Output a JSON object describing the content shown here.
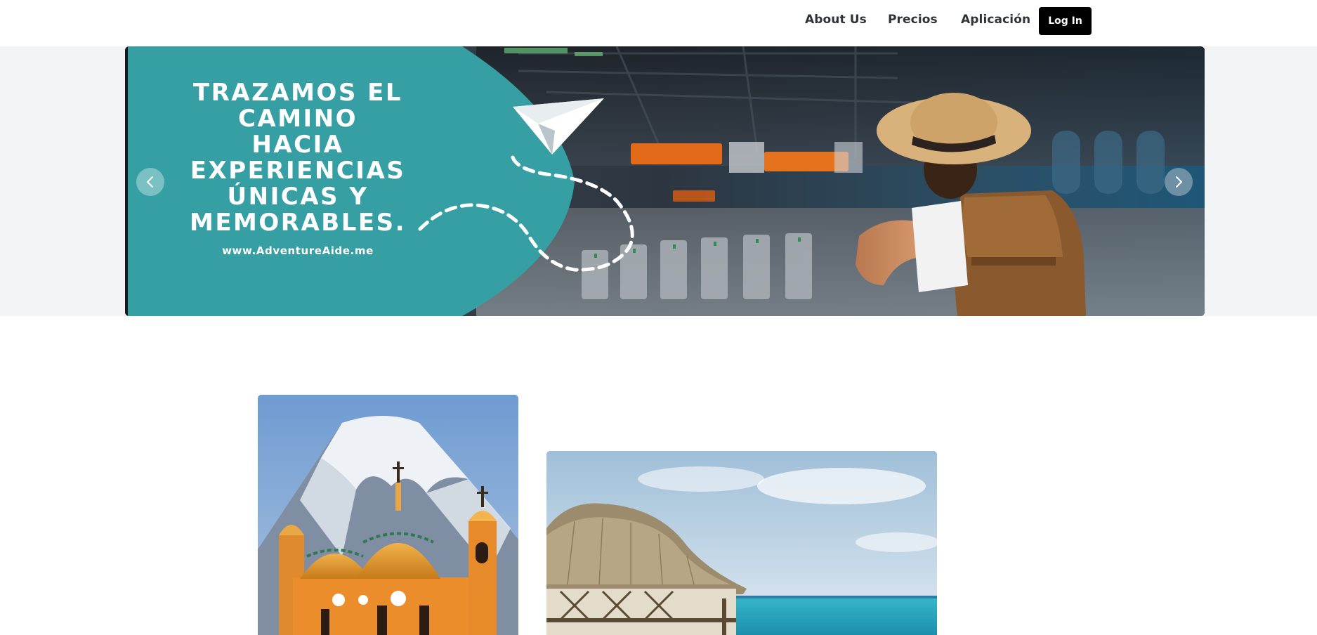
{
  "nav": {
    "items": [
      {
        "label": "About Us"
      },
      {
        "label": "Precios"
      },
      {
        "label": "Aplicación"
      }
    ],
    "login_label": "Log In"
  },
  "hero": {
    "headline_lines": [
      "TRAZAMOS EL",
      "CAMINO",
      "HACIA",
      "EXPERIENCIAS",
      "ÚNICAS Y",
      "MEMORABLES."
    ],
    "url": "www.AdventureAide.me",
    "accent_color": "#359fa3",
    "prev_icon": "chevron-left-icon",
    "next_icon": "chevron-right-icon"
  },
  "gallery": {
    "cards": [
      {
        "subject": "cathedral-volcano-image"
      },
      {
        "subject": "overwater-bungalow-image"
      }
    ]
  }
}
